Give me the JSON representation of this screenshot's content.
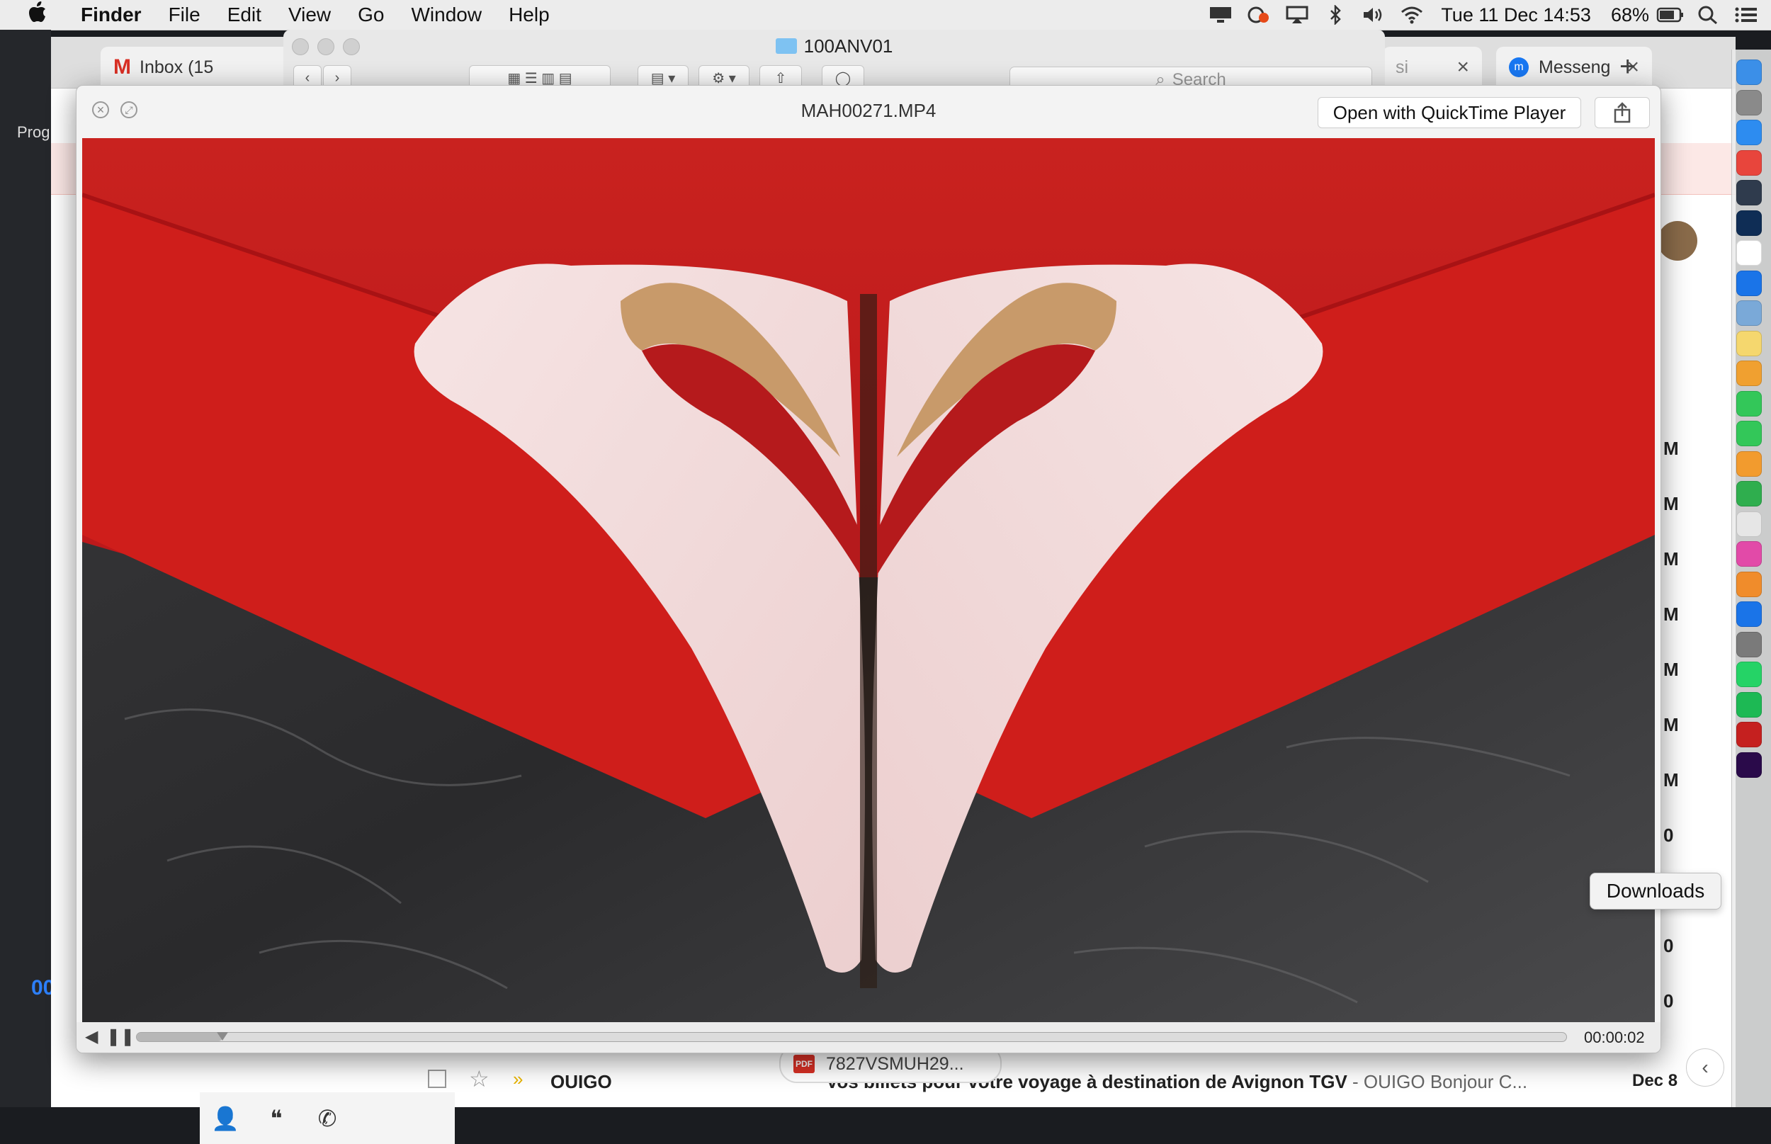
{
  "menubar": {
    "apple": "",
    "app_name": "Finder",
    "items": [
      "File",
      "Edit",
      "View",
      "Go",
      "Window",
      "Help"
    ],
    "clock": "Tue 11 Dec  14:53",
    "battery": "68%"
  },
  "left_app": {
    "label": "Prog",
    "timecode": "00"
  },
  "chrome": {
    "tabs": [
      {
        "label": "Inbox (15"
      },
      {
        "label": "si"
      },
      {
        "label": "Messeng"
      }
    ],
    "new_tab": "+",
    "avatar_label": ""
  },
  "inbox_right_letters": [
    "M",
    "M",
    "M",
    "M",
    "M",
    "M",
    "M",
    "0",
    "0",
    "0"
  ],
  "inbox_bottom_row": {
    "sender": "OUIGO",
    "subject": "Vos billets pour votre voyage à destination de Avignon TGV",
    "snippet": " - OUIGO Bonjour C...",
    "date": "Dec 8",
    "attachment": "7827VSMUH29..."
  },
  "finder": {
    "title": "100ANV01",
    "search_placeholder": "Search"
  },
  "quicklook": {
    "title": "MAH00271.MP4",
    "open_button": "Open with QuickTime Player",
    "timecode": "00:00:02",
    "progress": 0.06
  },
  "dock": {
    "tooltip": "Downloads",
    "icons": [
      "finder-icon",
      "launchpad-icon",
      "safari-icon",
      "chrome-icon",
      "lightroom-icon",
      "photoshop-icon",
      "calendar-icon",
      "app-store-icon",
      "preview-icon",
      "notes-icon",
      "photos-icon",
      "messages-icon",
      "facetime-icon",
      "pages-icon",
      "numbers-icon",
      "textedit-icon",
      "itunes-icon",
      "books-icon",
      "app-store-icon",
      "system-preferences-icon",
      "whatsapp-icon",
      "spotify-icon",
      "acrobat-icon",
      "premiere-icon"
    ],
    "colors": [
      "#3b8fe8",
      "#8a8a8a",
      "#2d8cf0",
      "#e8453c",
      "#2f3b4d",
      "#0f2d55",
      "#ffffff",
      "#1a74e8",
      "#7aa9d8",
      "#f5d76e",
      "#f0a030",
      "#33c759",
      "#33c759",
      "#f29b2e",
      "#2fae4e",
      "#e6e6e6",
      "#e24aa8",
      "#f08c2b",
      "#1a74e8",
      "#7a7a7a",
      "#25d366",
      "#1db954",
      "#c5201f",
      "#2a0a4a"
    ]
  }
}
